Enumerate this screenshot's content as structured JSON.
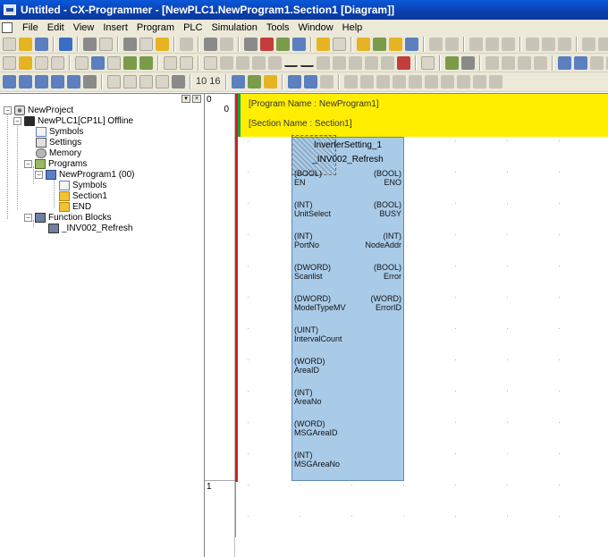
{
  "window": {
    "title": "Untitled - CX-Programmer - [NewPLC1.NewProgram1.Section1 [Diagram]]"
  },
  "menu": {
    "items": [
      "File",
      "Edit",
      "View",
      "Insert",
      "Program",
      "PLC",
      "Simulation",
      "Tools",
      "Window",
      "Help"
    ]
  },
  "toolbars": {
    "row3_text": [
      "10",
      "16"
    ]
  },
  "tree": {
    "items": [
      {
        "label": "NewProject",
        "icon": "project-icon",
        "expander": "−"
      },
      {
        "label": "NewPLC1[CP1L] Offline",
        "icon": "plc-icon",
        "expander": "−"
      },
      {
        "label": "Symbols",
        "icon": "symbols-icon"
      },
      {
        "label": "Settings",
        "icon": "settings-icon"
      },
      {
        "label": "Memory",
        "icon": "memory-icon"
      },
      {
        "label": "Programs",
        "icon": "programs-icon",
        "expander": "−"
      },
      {
        "label": "NewProgram1 (00)",
        "icon": "program-icon",
        "expander": "−"
      },
      {
        "label": "Symbols",
        "icon": "symbols-icon"
      },
      {
        "label": "Section1",
        "icon": "section-icon"
      },
      {
        "label": "END",
        "icon": "section-icon"
      },
      {
        "label": "Function Blocks",
        "icon": "function-blocks-icon",
        "expander": "−"
      },
      {
        "label": "_INV002_Refresh",
        "icon": "function-block-icon"
      }
    ]
  },
  "rungs": {
    "numbers": [
      "0",
      "1"
    ],
    "address": "0"
  },
  "diagram": {
    "program_name": "[Program Name : NewProgram1]",
    "section_name": "[Section Name : Section1]",
    "colors": {
      "bus": "#d21f1f",
      "banner": "#ffee00",
      "block": "#a9cbe8",
      "marker": "#1aa04a"
    }
  },
  "function_block": {
    "instance": "InverterSetting_1",
    "type": "_INV002_Refresh",
    "inputs": [
      {
        "type": "(BOOL)",
        "name": "EN"
      },
      {
        "type": "(INT)",
        "name": "UnitSelect"
      },
      {
        "type": "(INT)",
        "name": "PortNo"
      },
      {
        "type": "(DWORD)",
        "name": "Scanlist"
      },
      {
        "type": "(DWORD)",
        "name": "ModelTypeMV"
      },
      {
        "type": "(UINT)",
        "name": "IntervalCount"
      },
      {
        "type": "(WORD)",
        "name": "AreaID"
      },
      {
        "type": "(INT)",
        "name": "AreaNo"
      },
      {
        "type": "(WORD)",
        "name": "MSGAreaID"
      },
      {
        "type": "(INT)",
        "name": "MSGAreaNo"
      }
    ],
    "outputs": [
      {
        "type": "(BOOL)",
        "name": "ENO"
      },
      {
        "type": "(BOOL)",
        "name": "BUSY"
      },
      {
        "type": "(INT)",
        "name": "NodeAddr"
      },
      {
        "type": "(BOOL)",
        "name": "Error"
      },
      {
        "type": "(WORD)",
        "name": "ErrorID"
      }
    ]
  }
}
